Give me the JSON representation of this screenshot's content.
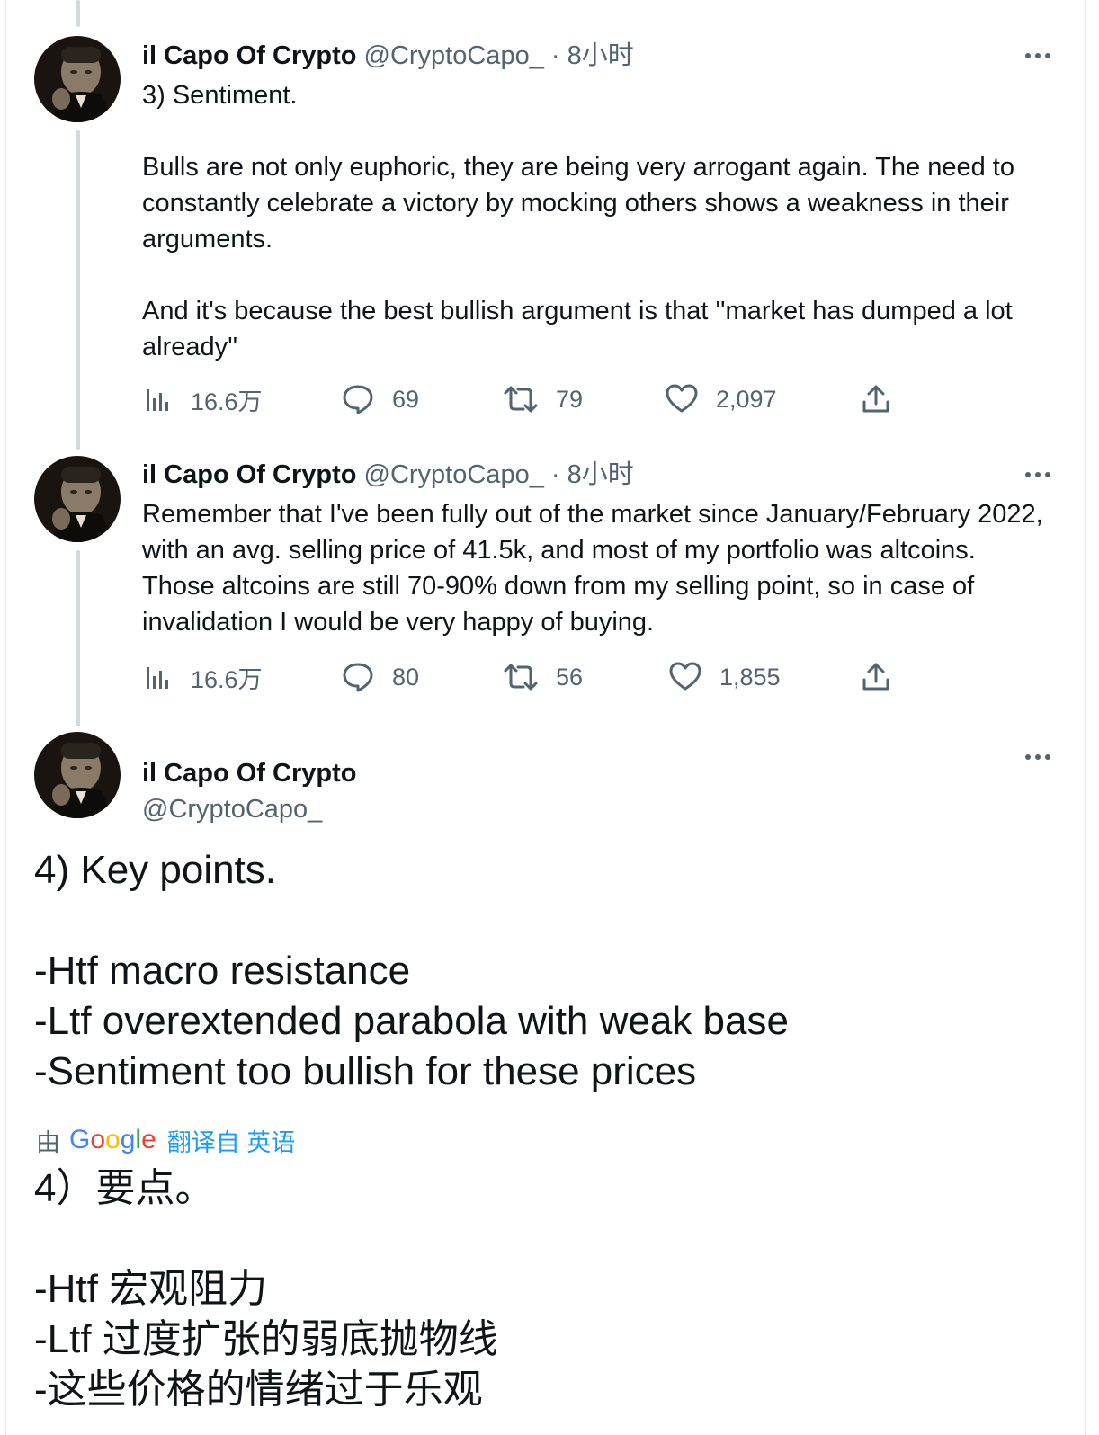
{
  "colors": {
    "accent": "#1d9bf0",
    "text": "#0f1419",
    "secondary": "#536471",
    "thread_line": "#cfd9de"
  },
  "tweets": [
    {
      "name": "il Capo Of Crypto",
      "handle": "@CryptoCapo_",
      "dot": "·",
      "time": "8小时",
      "text": "3) Sentiment.\n\nBulls are not only euphoric, they are being very arrogant again. The need to constantly celebrate a victory by mocking others shows a weakness in their arguments.\n\nAnd it's because the best bullish argument is that ''market has dumped a lot already''",
      "views": "16.6万",
      "replies": "69",
      "retweets": "79",
      "likes": "2,097"
    },
    {
      "name": "il Capo Of Crypto",
      "handle": "@CryptoCapo_",
      "dot": "·",
      "time": "8小时",
      "text": "Remember that I've been fully out of the market since January/February 2022, with an avg. selling price of 41.5k, and most of my portfolio was altcoins. Those altcoins are still 70-90% down from my selling point, so in case of invalidation I would be very happy of buying.",
      "views": "16.6万",
      "replies": "80",
      "retweets": "56",
      "likes": "1,855"
    }
  ],
  "main_tweet": {
    "name": "il Capo Of Crypto",
    "handle": "@CryptoCapo_",
    "text": "4) Key points.\n\n-Htf macro resistance\n-Ltf overextended parabola with weak base\n-Sentiment too bullish for these prices",
    "translation_by": "由",
    "translation_brand": "Google",
    "translation_label": "翻译自 英语",
    "translated_text": "4）要点。\n\n-Htf 宏观阻力\n-Ltf 过度扩张的弱底抛物线\n-这些价格的情绪过于乐观"
  },
  "icons": {
    "views": "views-chart-icon",
    "reply": "reply-bubble-icon",
    "retweet": "retweet-arrows-icon",
    "like": "heart-icon",
    "share": "share-upload-icon",
    "more": "more-dots-icon"
  }
}
